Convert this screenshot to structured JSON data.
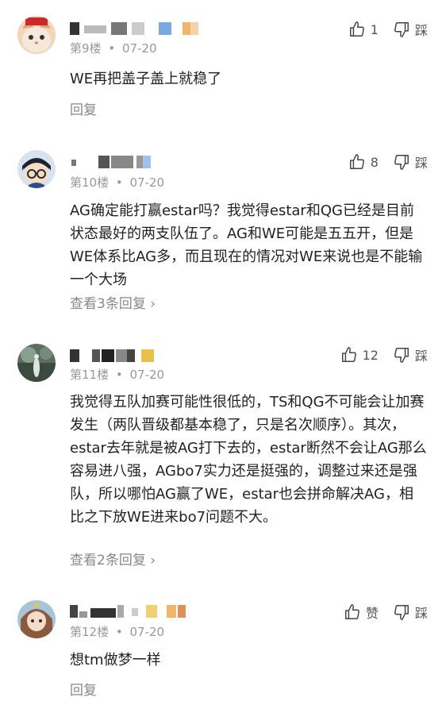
{
  "posts": [
    {
      "floor": "第9楼",
      "date": "07-20",
      "likes": "1",
      "dislike_label": "踩",
      "text": "WE再把盖子盖上就稳了",
      "reply_label": "回复"
    },
    {
      "floor": "第10楼",
      "date": "07-20",
      "likes": "8",
      "dislike_label": "踩",
      "text": "AG确定能打赢estar吗？我觉得estar和QG已经是目前状态最好的两支队伍了。AG和WE可能是五五开，但是WE体系比AG多，而且现在的情况对WE来说也是不能输一个大场",
      "reply_label": "查看3条回复 ›"
    },
    {
      "floor": "第11楼",
      "date": "07-20",
      "likes": "12",
      "dislike_label": "踩",
      "text": "我觉得五队加赛可能性很低的，TS和QG不可能会让加赛发生（两队晋级都基本稳了，只是名次顺序）。其次，estar去年就是被AG打下去的，estar断然不会让AG那么容易进八强，AGbo7实力还是挺强的，调整过来还是强队，所以哪怕AG赢了WE，estar也会拼命解决AG，相比之下放WE进来bo7问题不大。",
      "reply_label": "查看2条回复 ›"
    },
    {
      "floor": "第12楼",
      "date": "07-20",
      "likes": "赞",
      "dislike_label": "踩",
      "text": "想tm做梦一样",
      "reply_label": "回复"
    }
  ],
  "meta_separator": "•",
  "colors": {
    "text": "#222222",
    "meta": "#999999",
    "reply": "#888888"
  },
  "icons": {
    "like": "thumbs-up-icon",
    "dislike": "thumbs-down-icon"
  }
}
